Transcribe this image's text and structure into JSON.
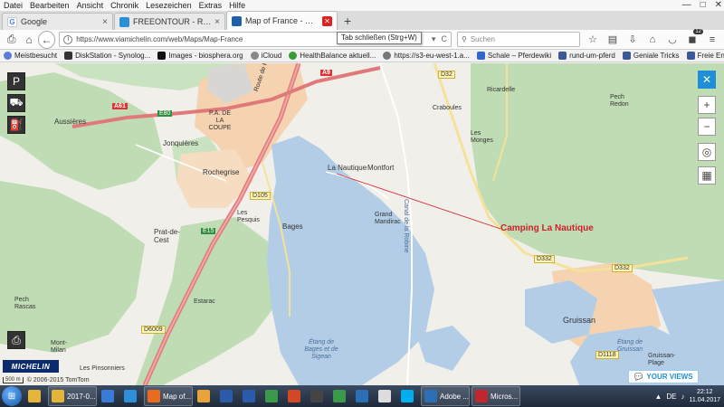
{
  "menu": [
    "Datei",
    "Bearbeiten",
    "Ansicht",
    "Chronik",
    "Lesezeichen",
    "Extras",
    "Hilfe"
  ],
  "window_controls": {
    "minimize": "—",
    "maximize": "□",
    "close": "✕"
  },
  "tabs": [
    {
      "title": "Google",
      "favicon_color": "#4285f4",
      "close": "×",
      "active": false
    },
    {
      "title": "FREEONTOUR - Reiseberic...",
      "favicon_color": "#2a8fd4",
      "close": "×",
      "active": false
    },
    {
      "title": "Map of France - Michelin F...",
      "favicon_color": "#1e5fa8",
      "close": "×",
      "active": true
    }
  ],
  "new_tab": "+",
  "nav": {
    "url": "https://www.viamichelin.com/web/Maps/Map-France",
    "search_placeholder": "Suchen",
    "tooltip": "Tab schließen (Strg+W)",
    "reload": "C",
    "addon_badge": "12"
  },
  "bookmarks": [
    {
      "label": "Meistbesucht",
      "color": "#5b7bd5"
    },
    {
      "label": "DiskStation - Synolog...",
      "color": "#333333"
    },
    {
      "label": "Images - biosphera.org",
      "color": "#111111"
    },
    {
      "label": "iCloud",
      "color": "#888888"
    },
    {
      "label": "HealthBalance aktuell...",
      "color": "#3a9a3a"
    },
    {
      "label": "https://s3-eu-west-1.a...",
      "color": "#777777"
    },
    {
      "label": "Schale – Pferdewiki",
      "color": "#3366cc"
    },
    {
      "label": "rund-um-pferd",
      "color": "#3b5998"
    },
    {
      "label": "Geniale Tricks",
      "color": "#3b5998"
    },
    {
      "label": "Freie Energien, Pendel...",
      "color": "#3b5998"
    }
  ],
  "map": {
    "labels": {
      "aussieres": "Aussières",
      "pa_coupe": "P.A. DE LA COUPE",
      "route_perpignan": "Route de Perpignan",
      "jonquieres": "Jonquières",
      "rochegrise": "Rochegrise",
      "les_pesquis": "Les Pesquis",
      "bages": "Bages",
      "prat_de_cest": "Prat-de-Cest",
      "estarac": "Estarac",
      "pech_rascas": "Pech Rascas",
      "mont_milan": "Mont-Milan",
      "les_pinsonniers": "Les Pinsonniers",
      "la_nautique": "La Nautique",
      "montfort": "Montfort",
      "grand_mandirac": "Grand Mandirac",
      "canal": "Canal de la Robine",
      "craboules": "Craboules",
      "ricardelle": "Ricardelle",
      "les_monges": "Les Monges",
      "pech_redon": "Pech Redon",
      "gruissan": "Gruissan",
      "gruissan_plage": "Gruissan-Plage",
      "etang_bages": "Étang de Bages et de Sigean",
      "etang_gruissan": "Étang de Gruissan",
      "a9": "A9",
      "a61": "A61",
      "e15": "E15",
      "e80": "E80",
      "d105": "D105",
      "d32": "D32",
      "d332": "D332",
      "d6009": "D6009",
      "d332b": "D332",
      "d1118": "D1118"
    },
    "camping_label": "Camping La Nautique",
    "scale": "500 m",
    "copyright": "© 2006-2015 TomTom",
    "michelin": "MICHELIN",
    "your_views": "YOUR VIEWS",
    "colors": {
      "water": "#b4cde6",
      "forest": "#bfdcb4",
      "urban": "#f5d2b0",
      "motorway": "#e07a7a",
      "road": "#f5e29a"
    }
  },
  "taskbar": {
    "start": "⊞",
    "items": [
      {
        "label": "",
        "color": "#e5b53a",
        "wide": false
      },
      {
        "label": "2017-0...",
        "color": "#e5b53a",
        "wide": true
      },
      {
        "label": "",
        "color": "#3a7bd5",
        "wide": false
      },
      {
        "label": "",
        "color": "#2d8fd8",
        "wide": false
      },
      {
        "label": "Map of...",
        "color": "#e86b1e",
        "wide": true
      },
      {
        "label": "",
        "color": "#e8a33a",
        "wide": false
      },
      {
        "label": "",
        "color": "#2b5cab",
        "wide": false
      },
      {
        "label": "",
        "color": "#2b5cab",
        "wide": false
      },
      {
        "label": "",
        "color": "#3a9a4a",
        "wide": false
      },
      {
        "label": "",
        "color": "#d24726",
        "wide": false
      },
      {
        "label": "",
        "color": "#444444",
        "wide": false
      },
      {
        "label": "",
        "color": "#3a9a4a",
        "wide": false
      },
      {
        "label": "",
        "color": "#2b6fb5",
        "wide": false
      },
      {
        "label": "",
        "color": "#dddddd",
        "wide": false
      },
      {
        "label": "",
        "color": "#00aff0",
        "wide": false
      },
      {
        "label": "Adobe ...",
        "color": "#2b6fb5",
        "wide": true
      },
      {
        "label": "Micros...",
        "color": "#c1272d",
        "wide": true
      }
    ],
    "lang": "DE",
    "time": "22:12",
    "date": "11.04.2017"
  }
}
